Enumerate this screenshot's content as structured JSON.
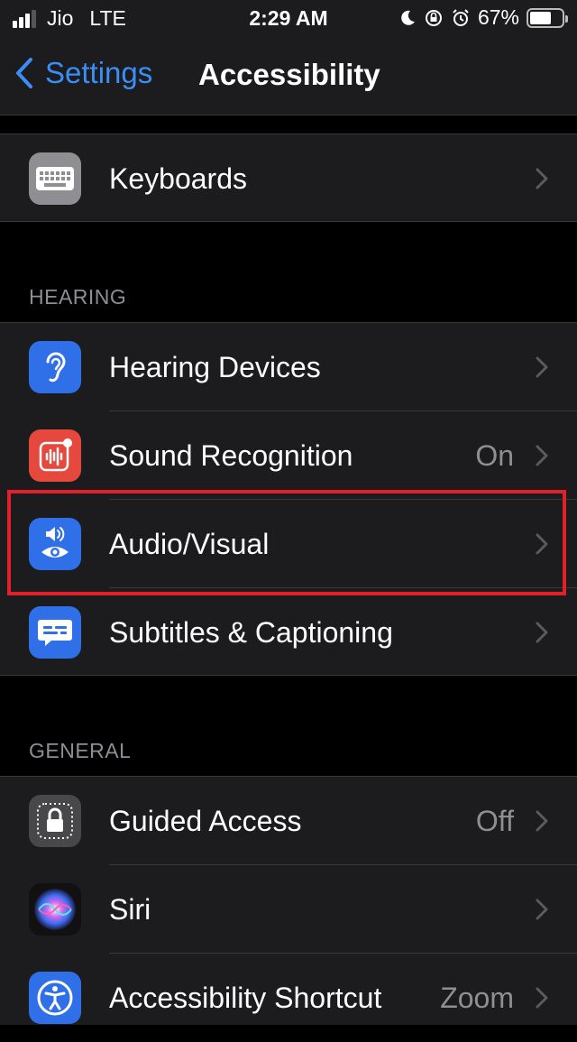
{
  "status_bar": {
    "carrier": "Jio",
    "network": "LTE",
    "time": "2:29 AM",
    "battery": "67%"
  },
  "nav": {
    "back_label": "Settings",
    "title": "Accessibility"
  },
  "rows": {
    "keyboards": {
      "label": "Keyboards"
    },
    "hearing_devices": {
      "label": "Hearing Devices"
    },
    "sound_recognition": {
      "label": "Sound Recognition",
      "value": "On"
    },
    "audio_visual": {
      "label": "Audio/Visual"
    },
    "subtitles": {
      "label": "Subtitles & Captioning"
    },
    "guided_access": {
      "label": "Guided Access",
      "value": "Off"
    },
    "siri": {
      "label": "Siri"
    },
    "shortcut": {
      "label": "Accessibility Shortcut",
      "value": "Zoom"
    }
  },
  "sections": {
    "hearing": "HEARING",
    "general": "GENERAL"
  },
  "colors": {
    "accent": "#3a8ef6",
    "blue_icon": "#2f6fe8",
    "red_icon": "#e5483c",
    "highlight": "#e0202a"
  }
}
